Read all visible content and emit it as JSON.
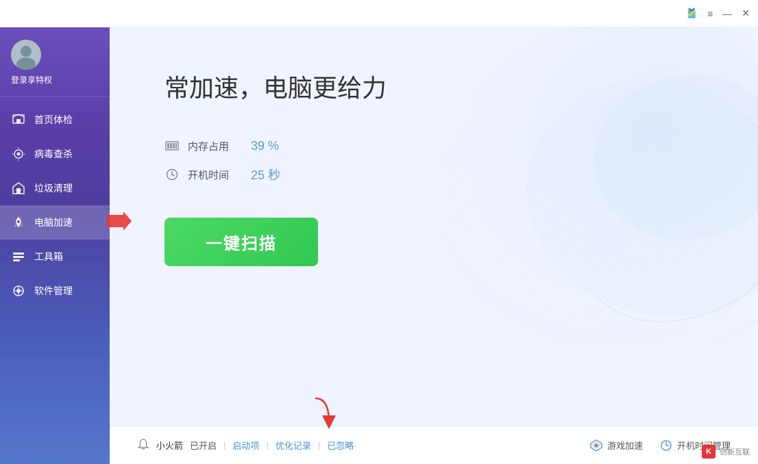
{
  "titleBar": {
    "icons": [
      "shirt-icon",
      "menu-icon",
      "minimize-icon",
      "close-icon"
    ]
  },
  "sidebar": {
    "profile": {
      "login_label": "登录享特权"
    },
    "items": [
      {
        "id": "home",
        "label": "首页体检",
        "icon": "home-icon"
      },
      {
        "id": "virus",
        "label": "病毒查杀",
        "icon": "virus-icon"
      },
      {
        "id": "clean",
        "label": "垃圾清理",
        "icon": "clean-icon"
      },
      {
        "id": "accelerate",
        "label": "电脑加速",
        "icon": "rocket-icon",
        "active": true
      },
      {
        "id": "tools",
        "label": "工具箱",
        "icon": "tools-icon"
      },
      {
        "id": "software",
        "label": "软件管理",
        "icon": "software-icon"
      }
    ]
  },
  "main": {
    "title": "常加速，电脑更给力",
    "stats": [
      {
        "id": "memory",
        "icon": "memory-icon",
        "label": "内存占用",
        "value": "39 %"
      },
      {
        "id": "boot",
        "icon": "clock-icon",
        "label": "开机时间",
        "value": "25 秒"
      }
    ],
    "scanButton": "一键扫描"
  },
  "bottomBar": {
    "left": {
      "icon": "bell-icon",
      "appName": "小火箭",
      "status": "已开启",
      "links": [
        "启动项",
        "优化记录",
        "已忽略"
      ]
    },
    "right": [
      {
        "id": "game",
        "icon": "game-icon",
        "label": "游戏加速"
      },
      {
        "id": "boot-mgr",
        "icon": "boot-icon",
        "label": "开机时间管理"
      }
    ]
  },
  "watermark": {
    "icon_text": "K",
    "text": "创新互联"
  }
}
